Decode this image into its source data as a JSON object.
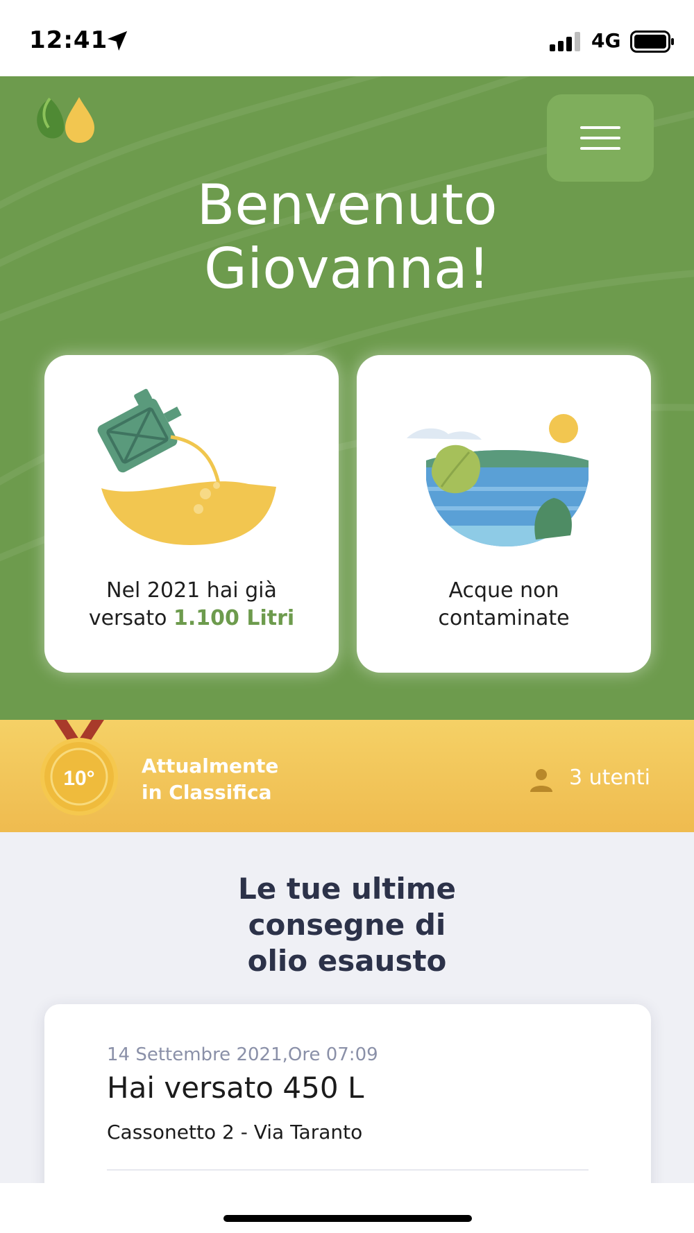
{
  "status_bar": {
    "time": "12:41",
    "network": "4G",
    "icons": [
      "location-arrow-icon",
      "signal-icon",
      "battery-icon"
    ]
  },
  "header": {
    "logo": "leaf-drop-logo",
    "menu_icon": "hamburger-icon",
    "welcome_line1": "Benvenuto",
    "welcome_line2": "Giovanna!"
  },
  "stats": {
    "liters_prefix_line1": "Nel 2021 hai già",
    "liters_prefix_line2": "versato ",
    "liters_value": "1.100 Litri",
    "water_line1": "Acque non",
    "water_line2": "contaminate"
  },
  "ranking": {
    "position": "10°",
    "label_line1": "Attualmente",
    "label_line2": "in Classifica",
    "users": "3 utenti"
  },
  "deliveries": {
    "title_line1": "Le tue ultime",
    "title_line2": "consegne di",
    "title_line3": "olio esausto",
    "items": [
      {
        "datetime": "14 Settembre 2021,Ore 07:09",
        "summary": "Hai versato 450 L",
        "location": "Cassonetto 2 - Via Taranto"
      }
    ]
  },
  "colors": {
    "hero_green": "#6d9b4d",
    "menu_green": "#7fae5c",
    "highlight_green": "#6d9b4d",
    "ranking_yellow": "#f5d166",
    "section_bg": "#eff0f5"
  }
}
